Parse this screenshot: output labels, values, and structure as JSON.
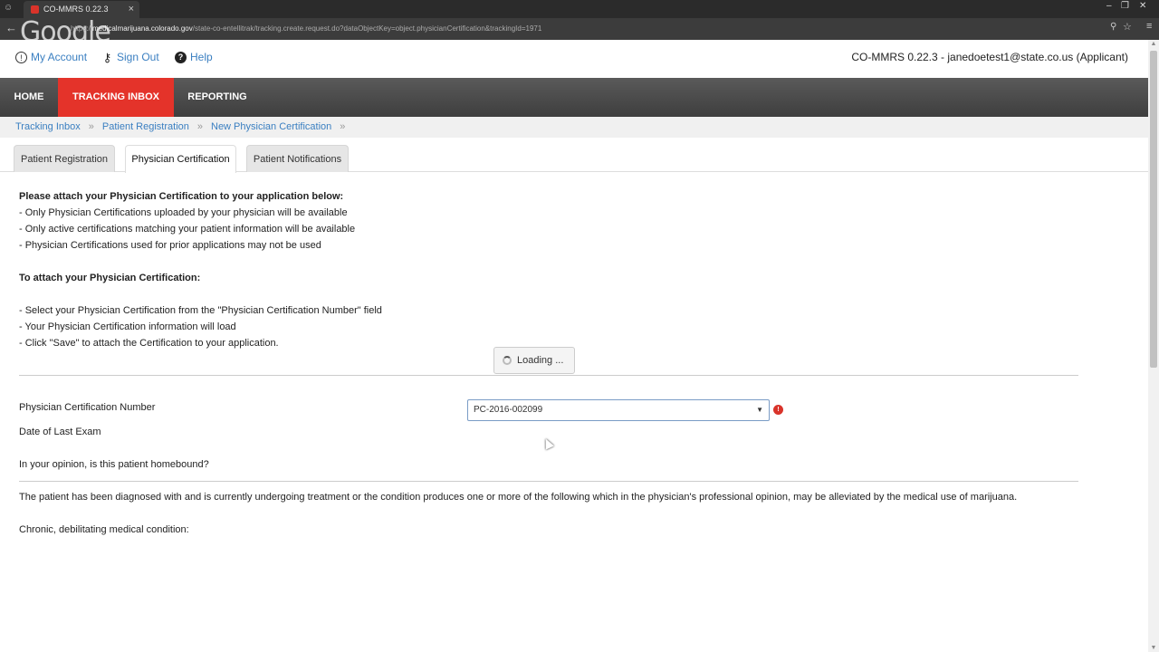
{
  "browser": {
    "tab_title": "CO-MMRS 0.22.3",
    "tab_close": "×",
    "google_watermark": "Google",
    "url_prefix": "https://",
    "url_host": "medicalmarijuana.colorado.gov",
    "url_path": "/state-co-entellitrak/tracking.create.request.do?dataObjectKey=object.physicianCertification&trackingId=1971"
  },
  "userbar": {
    "my_account": "My Account",
    "sign_out": "Sign Out",
    "help": "Help",
    "app_version": "CO-MMRS 0.22.3",
    "dash": " - ",
    "user": "janedoetest1@state.co.us (Applicant)"
  },
  "nav": {
    "home": "HOME",
    "tracking_inbox": "TRACKING INBOX",
    "reporting": "REPORTING"
  },
  "breadcrumb": {
    "items": [
      "Tracking Inbox",
      "Patient Registration",
      "New Physician Certification"
    ],
    "sep": "»"
  },
  "tabs": {
    "patient_registration": "Patient Registration",
    "physician_certification": "Physician Certification",
    "patient_notifications": "Patient Notifications"
  },
  "instructions": {
    "heading1": "Please attach your Physician Certification to your application below:",
    "l1": "- Only Physician Certifications uploaded by your physician will be available",
    "l2": "- Only active certifications matching your patient information will be available",
    "l3": "- Physician Certifications used for prior applications may not be used",
    "heading2": "To attach your Physician Certification:",
    "s1": "- Select your Physician Certification from the \"Physician Certification Number\" field",
    "s2": "- Your Physician Certification information will load",
    "s3": "- Click \"Save\" to attach the Certification to your application."
  },
  "loading_text": "Loading ...",
  "form": {
    "cert_number_label": "Physician Certification Number",
    "cert_number_value": "PC-2016-002099",
    "last_exam_label": "Date of Last Exam",
    "homebound_label": "In your opinion, is this patient homebound?",
    "diagnosis_text": "The patient has been diagnosed with and is currently undergoing treatment or the condition produces one or more of the following which in the physician's professional opinion, may be alleviated by the medical use of marijuana.",
    "chronic_label": "Chronic, debilitating medical condition:"
  }
}
